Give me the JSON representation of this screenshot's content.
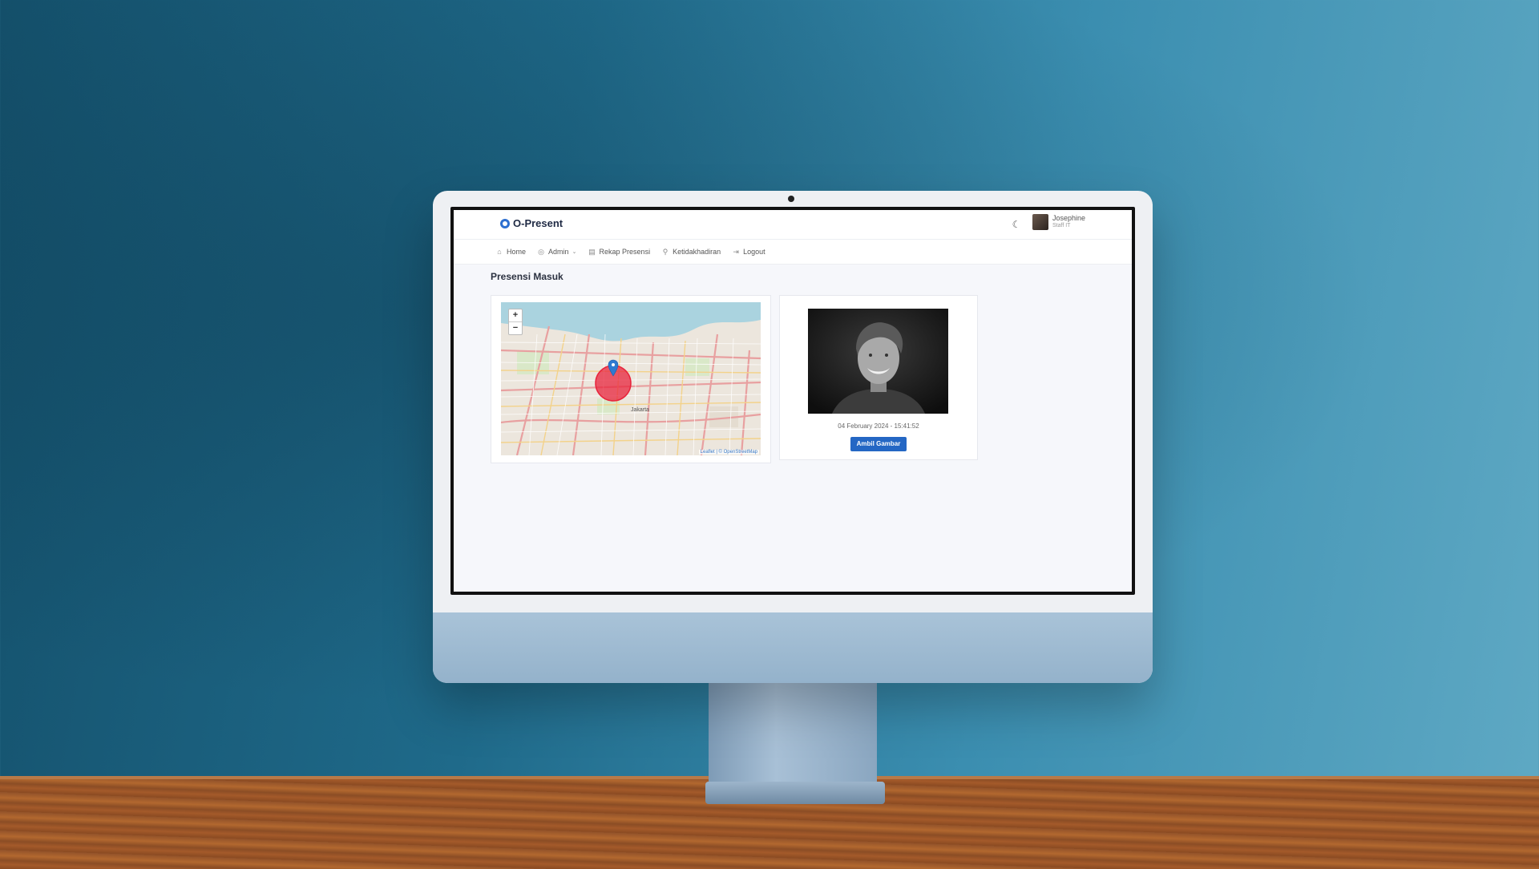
{
  "app": {
    "name": "O-Present",
    "user": {
      "name": "Josephine",
      "role": "Staff IT"
    }
  },
  "nav": [
    {
      "label": "Home",
      "icon": "home-icon"
    },
    {
      "label": "Admin",
      "icon": "admin-icon",
      "has_dropdown": true
    },
    {
      "label": "Rekap Presensi",
      "icon": "clipboard-icon"
    },
    {
      "label": "Ketidakhadiran",
      "icon": "user-absent-icon"
    },
    {
      "label": "Logout",
      "icon": "logout-icon"
    }
  ],
  "page": {
    "title": "Presensi Masuk"
  },
  "map": {
    "zoom_in": "+",
    "zoom_out": "−",
    "city_label": "Jakarta",
    "attribution": "Leaflet | © OpenStreetMap",
    "radius_color": "#e8243c",
    "marker_color": "#2e7ad1"
  },
  "capture": {
    "timestamp": "04 February 2024 - 15:41:52",
    "button_label": "Ambil Gambar"
  },
  "colors": {
    "accent": "#2467c4",
    "background": "#f6f7fb"
  }
}
